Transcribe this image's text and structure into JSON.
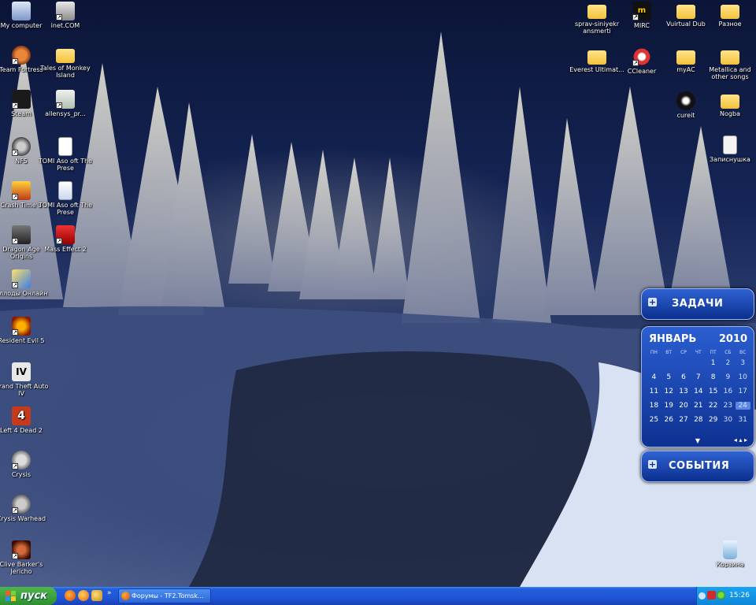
{
  "desktop": {
    "left_icons": [
      {
        "name": "my-computer",
        "label": "My computer"
      },
      {
        "name": "inet-com",
        "label": "inet.COM"
      },
      {
        "name": "team-fortress",
        "label": "Team Fortress"
      },
      {
        "name": "tales-of-monkey-island",
        "label": "Tales of Monkey Island"
      },
      {
        "name": "steam",
        "label": "Steam"
      },
      {
        "name": "allensys",
        "label": "allensys_pr..."
      },
      {
        "name": "nfs",
        "label": "NFS"
      },
      {
        "name": "tomi-1",
        "label": "TOMI Aso oft The Prese"
      },
      {
        "name": "crash-time",
        "label": "Crash Time 3"
      },
      {
        "name": "tomi-2",
        "label": "TOMI Aso oft The Prese"
      },
      {
        "name": "dragon-age",
        "label": "Dragon Age Origins"
      },
      {
        "name": "mass-effect-2",
        "label": "Mass Effect 2"
      },
      {
        "name": "allods",
        "label": "Аллоды Онлайн"
      },
      {
        "name": "resident-evil-5",
        "label": "Resident Evil 5"
      },
      {
        "name": "gta-iv",
        "label": "Grand Theft Auto IV"
      },
      {
        "name": "left-4-dead-2",
        "label": "Left 4 Dead 2"
      },
      {
        "name": "crysis",
        "label": "Crysis"
      },
      {
        "name": "crysis-warhead",
        "label": "Crysis Warhead"
      },
      {
        "name": "clive-barker",
        "label": "Clive Barker's Jericho"
      }
    ],
    "right_icons": [
      {
        "name": "sprav",
        "label": "sprav-siniyekr ansmerti"
      },
      {
        "name": "mirc",
        "label": "MIRC"
      },
      {
        "name": "vuirtual-dub",
        "label": "Vuirtual Dub"
      },
      {
        "name": "raznoe",
        "label": "Разное"
      },
      {
        "name": "everest",
        "label": "Everest Ultimat..."
      },
      {
        "name": "ccleaner",
        "label": "CCleaner"
      },
      {
        "name": "myac",
        "label": "myAC"
      },
      {
        "name": "metallica",
        "label": "Metallica and other songs"
      },
      {
        "name": "cureit",
        "label": "cureit"
      },
      {
        "name": "nogba",
        "label": "Nogba"
      },
      {
        "name": "zapisnaya",
        "label": "Записнушка"
      },
      {
        "name": "recycle-bin",
        "label": "Корзина"
      }
    ]
  },
  "gadgets": {
    "tasks_title": "ЗАДАЧИ",
    "events_title": "СОБЫТИЯ",
    "plus": "+"
  },
  "calendar": {
    "month": "ЯНВАРЬ",
    "year": "2010",
    "weekdays": [
      "ПН",
      "ВТ",
      "СР",
      "ЧТ",
      "ПТ",
      "СБ",
      "ВС"
    ],
    "weeks": [
      [
        "",
        "",
        "",
        "",
        "1",
        "2",
        "3"
      ],
      [
        "4",
        "5",
        "6",
        "7",
        "8",
        "9",
        "10"
      ],
      [
        "11",
        "12",
        "13",
        "14",
        "15",
        "16",
        "17"
      ],
      [
        "18",
        "19",
        "20",
        "21",
        "22",
        "23",
        "24"
      ],
      [
        "25",
        "26",
        "27",
        "28",
        "29",
        "30",
        "31"
      ]
    ],
    "today": "24",
    "down_arrow": "▼",
    "nav": "◂ ▴ ▸"
  },
  "taskbar": {
    "start_label": "пуск",
    "quicklaunch_more": "»",
    "task_title": "Форумы - TF2.Tomsk...",
    "clock": "15:26"
  },
  "colors": {
    "taskbar_blue": "#245edb",
    "start_green": "#3fa53f",
    "gadget_blue": "#1f4db8"
  }
}
